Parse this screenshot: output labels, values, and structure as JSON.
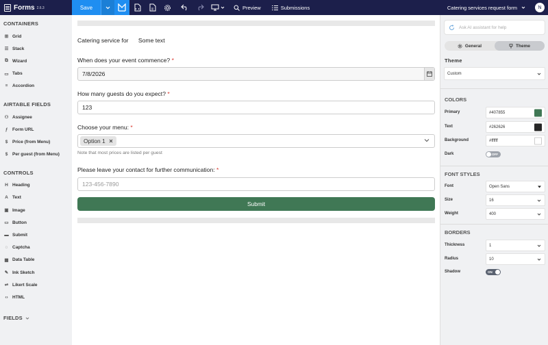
{
  "topbar": {
    "app_name": "Forms",
    "version": "2.6.3",
    "save_label": "Save",
    "preview_label": "Preview",
    "submissions_label": "Submissions",
    "form_name": "Catering services request form",
    "user_initial": "N"
  },
  "sidebar": {
    "containers_title": "CONTAINERS",
    "containers": [
      {
        "label": "Grid",
        "icon": "grid-icon"
      },
      {
        "label": "Stack",
        "icon": "stack-icon"
      },
      {
        "label": "Wizard",
        "icon": "wizard-icon"
      },
      {
        "label": "Tabs",
        "icon": "tabs-icon"
      },
      {
        "label": "Accordion",
        "icon": "accordion-icon"
      }
    ],
    "airtable_title": "AIRTABLE FIELDS",
    "airtable": [
      {
        "label": "Assignee",
        "icon": "people-icon"
      },
      {
        "label": "Form URL",
        "icon": "function-icon"
      },
      {
        "label": "Price (from Menu)",
        "icon": "dollar-icon"
      },
      {
        "label": "Per guest (from Menu)",
        "icon": "dollar-icon"
      }
    ],
    "controls_title": "CONTROLS",
    "controls": [
      {
        "label": "Heading",
        "icon": "heading-icon"
      },
      {
        "label": "Text",
        "icon": "text-icon"
      },
      {
        "label": "Image",
        "icon": "image-icon"
      },
      {
        "label": "Button",
        "icon": "button-icon"
      },
      {
        "label": "Submit",
        "icon": "submit-icon"
      },
      {
        "label": "Captcha",
        "icon": "captcha-icon"
      },
      {
        "label": "Data Table",
        "icon": "table-icon"
      },
      {
        "label": "Ink Sketch",
        "icon": "pen-icon"
      },
      {
        "label": "Likert Scale",
        "icon": "likert-icon"
      },
      {
        "label": "HTML",
        "icon": "code-icon"
      }
    ],
    "fields_title": "FIELDS"
  },
  "form": {
    "catering_label": "Catering service for",
    "catering_value": "Some text",
    "q1_label": "When does your event commence?",
    "q1_value": "7/8/2026",
    "q2_label": "How many guests do you expect?",
    "q2_value": "123",
    "q3_label": "Choose your menu:",
    "q3_chip": "Option 1",
    "q3_note": "Note that most prices are listed per guest",
    "q4_label": "Please leave your contact for further communication:",
    "q4_placeholder": "123-456-7890",
    "required_mark": "*",
    "submit_label": "Submit"
  },
  "panel": {
    "ai_placeholder": "Ask AI assistant for help",
    "tab_general": "General",
    "tab_theme": "Theme",
    "theme_heading": "Theme",
    "theme_value": "Custom",
    "colors_heading": "COLORS",
    "primary_label": "Primary",
    "primary_value": "#407855",
    "text_label": "Text",
    "text_value": "#262626",
    "background_label": "Background",
    "background_value": "#ffffff",
    "dark_label": "Dark",
    "dark_toggle": "OFF",
    "font_heading": "FONT STYLES",
    "font_label": "Font",
    "font_value": "Open Sans",
    "size_label": "Size",
    "size_value": "16",
    "weight_label": "Weight",
    "weight_value": "400",
    "borders_heading": "BORDERS",
    "thickness_label": "Thickness",
    "thickness_value": "1",
    "radius_label": "Radius",
    "radius_value": "10",
    "shadow_label": "Shadow",
    "shadow_toggle": "ON"
  },
  "colors": {
    "primary": "#407855",
    "text": "#262626",
    "background": "#ffffff",
    "topbar": "#1c1f4b",
    "accent": "#1f8ef1"
  }
}
